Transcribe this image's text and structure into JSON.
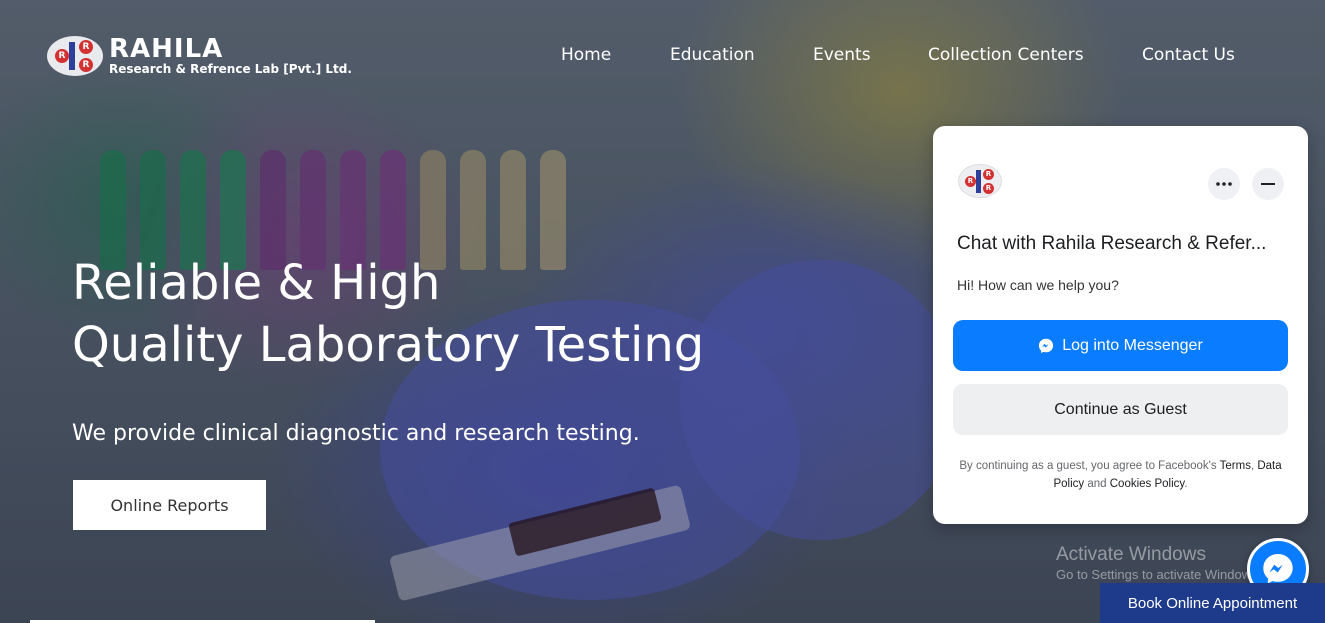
{
  "brand": {
    "name": "RAHILA",
    "subtitle": "Research & Refrence Lab [Pvt.] Ltd.",
    "logo_letter": "R"
  },
  "nav": {
    "items": [
      {
        "label": "Home"
      },
      {
        "label": "Education"
      },
      {
        "label": "Events"
      },
      {
        "label": "Collection Centers"
      },
      {
        "label": "Contact Us"
      }
    ]
  },
  "hero": {
    "headline_line1": "Reliable & High",
    "headline_line2": "Quality Laboratory Testing",
    "subline": "We provide clinical diagnostic and research testing.",
    "cta_label": "Online Reports"
  },
  "chat": {
    "title": "Chat with Rahila Research & Refer...",
    "greeting": "Hi! How can we help you?",
    "messenger_button": "Log into Messenger",
    "guest_button": "Continue as Guest",
    "legal_prefix": "By continuing as a guest, you agree to Facebook's",
    "terms_link": "Terms",
    "data_policy_link": "Data Policy",
    "and": "and",
    "cookies_link": "Cookies Policy",
    "more_icon": "more-icon",
    "minimize_icon": "minimize-icon"
  },
  "watermark": {
    "line1": "Activate Windows",
    "line2": "Go to Settings to activate Windows."
  },
  "book_button": "Book Online Appointment",
  "colors": {
    "messenger_blue": "#0a7cff",
    "book_bg": "#1e3a8a"
  }
}
